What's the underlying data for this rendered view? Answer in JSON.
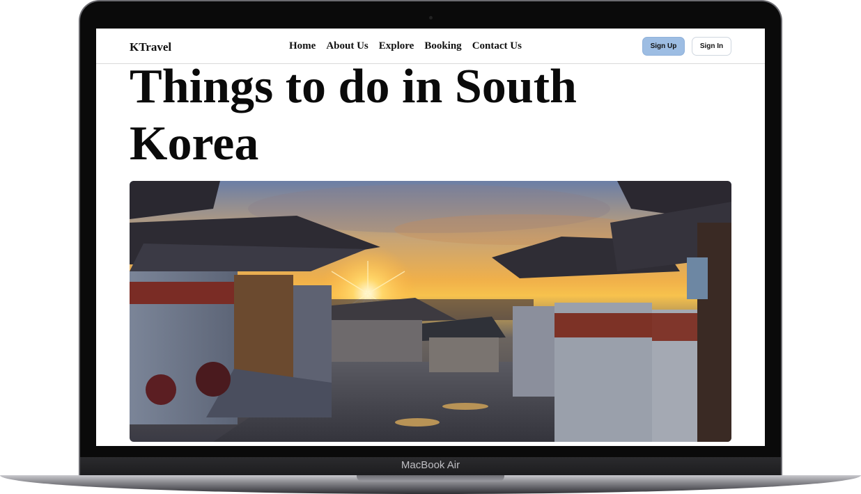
{
  "device": {
    "label": "MacBook Air"
  },
  "nav": {
    "logo": "KTravel",
    "links": [
      "Home",
      "About Us",
      "Explore",
      "Booking",
      "Contact Us"
    ],
    "signup_label": "Sign Up",
    "signin_label": "Sign In"
  },
  "main": {
    "title": "Things to do in South Korea"
  },
  "colors": {
    "signup_bg": "#9dbde3",
    "text": "#0a0a0a"
  }
}
